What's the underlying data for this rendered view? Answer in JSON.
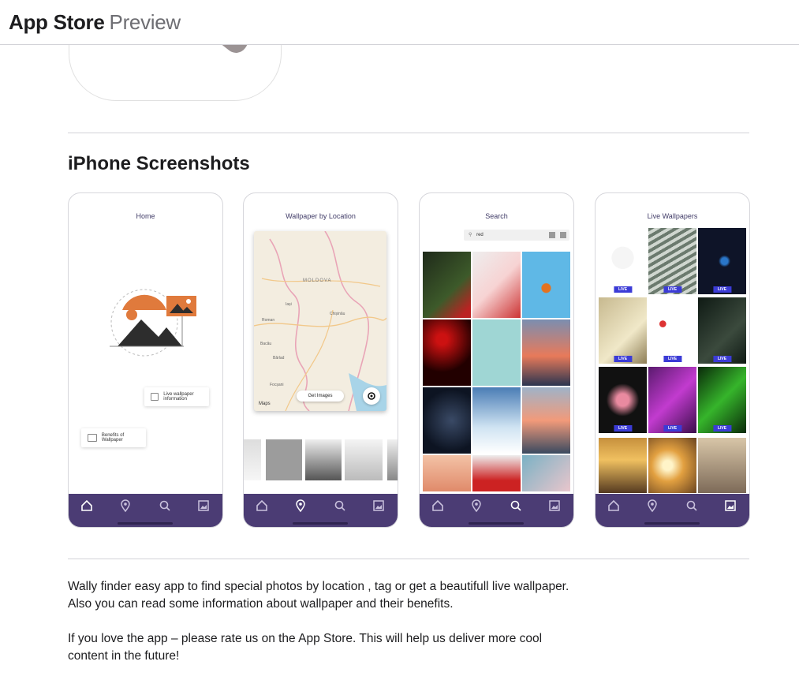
{
  "header": {
    "brand_bold": "App Store",
    "brand_light": "Preview"
  },
  "section": {
    "title": "iPhone Screenshots"
  },
  "screenshots": [
    {
      "title": "Home",
      "chips": [
        "Live wallpaper information",
        "Benefits of Wallpaper"
      ],
      "active_tab": "home"
    },
    {
      "title": "Wallpaper by Location",
      "map_labels": [
        "MOLDOVA",
        "Iași",
        "Chișinău",
        "Bacău",
        "Focșani",
        "Brăila",
        "Roman",
        "Bârlad"
      ],
      "button": "Get Images",
      "maps_label": "Maps",
      "active_tab": "location"
    },
    {
      "title": "Search",
      "query": "red",
      "active_tab": "search"
    },
    {
      "title": "Live Wallpapers",
      "badge": "LIVE",
      "active_tab": "gallery"
    }
  ],
  "description": {
    "p1": "Wally finder easy app to find special photos by location , tag or get a beautifull live wallpaper. Also you can read some information about wallpaper and their benefits.",
    "p2": "If you love the app – please rate us on the App Store. This will help us deliver more cool content in the future!"
  },
  "colors": {
    "tabbar": "#4b3c74",
    "accent_orange": "#e07a3c",
    "live_badge": "#3b3bd6"
  }
}
